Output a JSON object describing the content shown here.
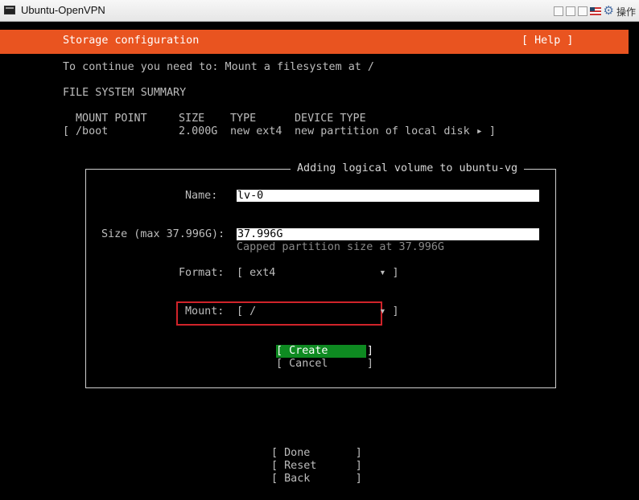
{
  "window": {
    "title": "Ubuntu-OpenVPN",
    "ops_label": "操作",
    "icons": [
      "minimize-icon",
      "restore-icon",
      "maximize-icon",
      "flag-icon",
      "gear-icon"
    ]
  },
  "header": {
    "title": "Storage configuration",
    "help": "[ Help ]",
    "color": "#e95420"
  },
  "instruction": "To continue you need to: Mount a filesystem at /",
  "summary": {
    "heading": "FILE SYSTEM SUMMARY",
    "columns": {
      "mount_point": "MOUNT POINT",
      "size": "SIZE",
      "type": "TYPE",
      "device_type": "DEVICE TYPE"
    },
    "rows": [
      {
        "open": "[",
        "mount_point": "/boot",
        "size": "2.000G",
        "type": "new ext4",
        "device_type": "new partition of local disk ▸ ]"
      }
    ]
  },
  "dialog": {
    "title": "Adding logical volume to ubuntu-vg",
    "name_label": "Name:",
    "name_value": "lv-0",
    "size_label": "Size (max 37.996G):",
    "size_value": "37.996G",
    "size_hint": "Capped partition size at 37.996G",
    "format_label": "Format:",
    "format_value": "[ ext4                ▾ ]",
    "mount_label": "Mount:",
    "mount_value": "[ /                   ▾ ]",
    "create_label": "[ Create      ]",
    "cancel_label": "[ Cancel      ]"
  },
  "footer": {
    "done": "[ Done       ]",
    "reset": "[ Reset      ]",
    "back": "[ Back       ]"
  },
  "colors": {
    "highlight_box": "#d0232a",
    "create_button": "#0e8a21"
  }
}
